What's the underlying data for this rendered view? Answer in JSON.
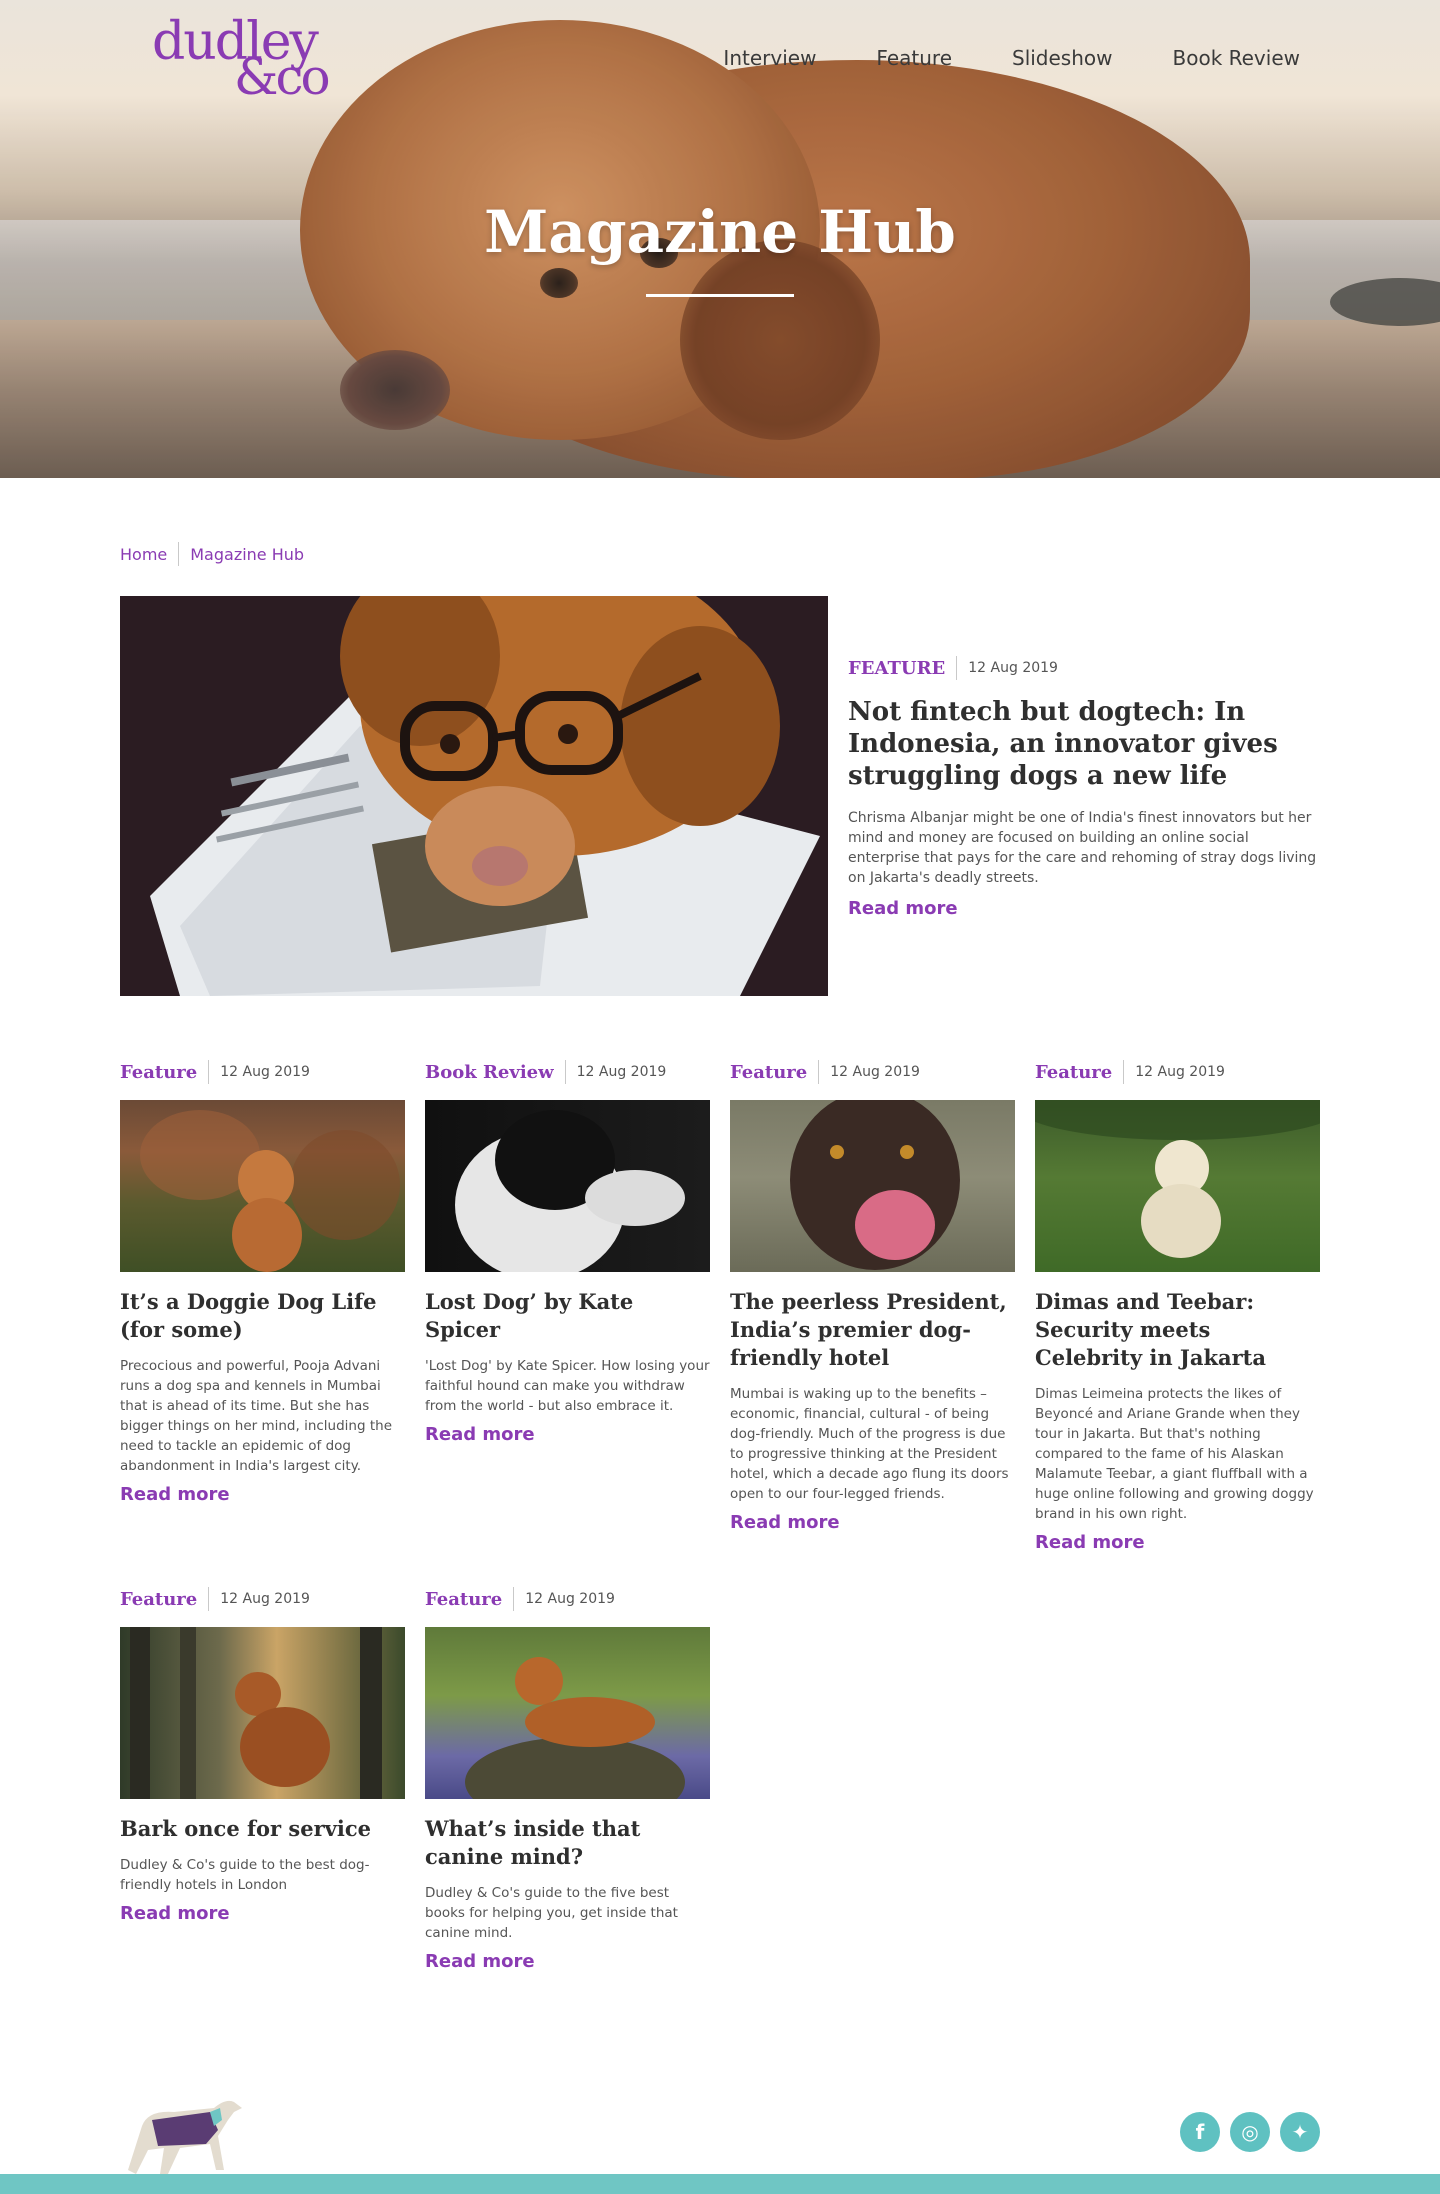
{
  "header": {
    "logo": {
      "line1": "dudley",
      "line2": "&co"
    },
    "nav": [
      {
        "label": "Interview"
      },
      {
        "label": "Feature"
      },
      {
        "label": "Slideshow"
      },
      {
        "label": "Book Review"
      }
    ]
  },
  "hero": {
    "title": "Magazine Hub"
  },
  "breadcrumb": [
    {
      "label": "Home"
    },
    {
      "label": "Magazine Hub"
    }
  ],
  "featured": {
    "category": "FEATURE",
    "date": "12 Aug 2019",
    "title": "Not fintech but dogtech: In Indonesia, an innovator gives struggling dogs a new life",
    "excerpt": "Chrisma Albanjar might be one of India's finest innovators but her mind and money are focused on building an online social enterprise that pays for the care and rehoming of stray dogs living on Jakarta's deadly streets.",
    "read_more": "Read more"
  },
  "cards": [
    {
      "category": "Feature",
      "date": "12 Aug 2019",
      "title": "It’s a Doggie Dog Life (for some)",
      "excerpt": "Precocious and powerful, Pooja Advani runs a dog spa and kennels in Mumbai that is ahead of its time. But she has bigger things on her mind, including the need to tackle an epidemic of dog abandonment in India's largest city.",
      "read_more": "Read more"
    },
    {
      "category": "Book Review",
      "date": "12 Aug 2019",
      "title": "Lost Dog’ by Kate Spicer",
      "excerpt": "'Lost Dog' by Kate Spicer. How losing your faithful hound can make you withdraw from the world - but also embrace it.",
      "read_more": "Read more"
    },
    {
      "category": "Feature",
      "date": "12 Aug 2019",
      "title": "The peerless President, India’s premier dog-friendly hotel",
      "excerpt": "Mumbai is waking up to the benefits – economic, financial, cultural - of being dog-friendly. Much of the progress is due to progressive thinking at the President hotel, which a decade ago flung its doors open to our four-legged friends.",
      "read_more": "Read more"
    },
    {
      "category": "Feature",
      "date": "12 Aug 2019",
      "title": "Dimas and Teebar: Security meets Celebrity in Jakarta",
      "excerpt": "Dimas Leimeina protects the likes of Beyoncé and Ariane Grande when they tour in Jakarta. But that's nothing compared to the fame of his Alaskan Malamute Teebar, a giant fluffball with a huge online following and growing doggy brand in his own right.",
      "read_more": "Read more"
    },
    {
      "category": "Feature",
      "date": "12 Aug 2019",
      "title": "Bark once for service",
      "excerpt": "Dudley & Co's guide to the best dog-friendly hotels in London",
      "read_more": "Read more"
    },
    {
      "category": "Feature",
      "date": "12 Aug 2019",
      "title": "What’s inside that canine mind?",
      "excerpt": "Dudley & Co's guide to the five best books for helping you, get inside that canine mind.",
      "read_more": "Read more"
    }
  ],
  "footer": {
    "socials": [
      {
        "icon": "facebook-icon",
        "glyph": "f"
      },
      {
        "icon": "instagram-icon",
        "glyph": "◎"
      },
      {
        "icon": "twitter-icon",
        "glyph": "✦"
      }
    ]
  },
  "colors": {
    "brand": "#8a3bb3",
    "teal": "#6fc6c4",
    "text": "#2f2f2f"
  }
}
